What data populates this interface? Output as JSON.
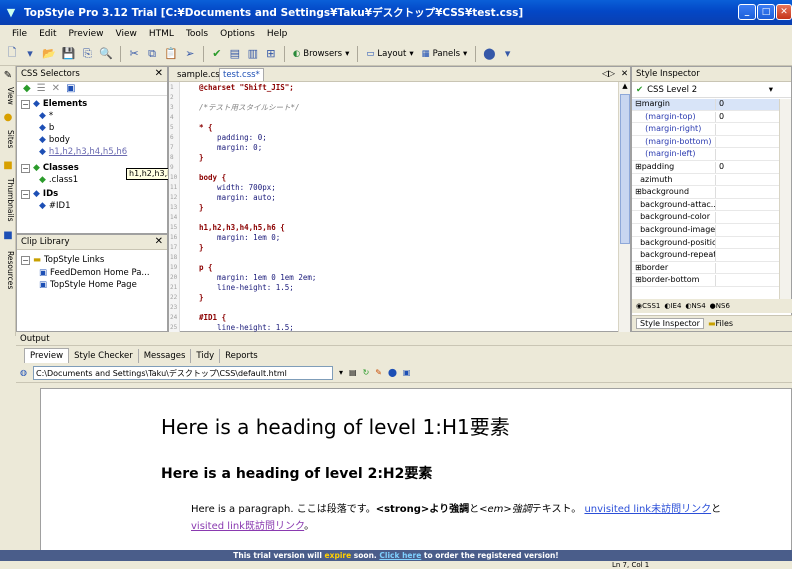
{
  "window": {
    "title": "TopStyle Pro 3.12 Trial  [C:¥Documents and Settings¥Taku¥デスクトップ¥CSS¥test.css]",
    "minimize": "_",
    "maximize": "□",
    "close": "✕"
  },
  "menu": [
    "File",
    "Edit",
    "Preview",
    "View",
    "HTML",
    "Tools",
    "Options",
    "Help"
  ],
  "toolbar": {
    "browsers_label": "Browsers",
    "layout_label": "Layout",
    "panels_label": "Panels"
  },
  "sidetabs": {
    "view": "View",
    "sites": "Sites",
    "thumbnails": "Thumbnails",
    "resources": "Resources"
  },
  "selectors_panel": {
    "title": "CSS Selectors",
    "elements_label": "Elements",
    "elements": [
      "*",
      "b",
      "body",
      "h1,h2,h3,h4,h5,h6"
    ],
    "classes_label": "Classes",
    "classes": [
      ".class1"
    ],
    "ids_label": "IDs",
    "ids": [
      "#ID1"
    ],
    "tooltip": "h1,h2,h3,h4,h5,h6"
  },
  "clip_library": {
    "title": "Clip Library",
    "group": "TopStyle Links",
    "items": [
      "FeedDemon Home Pa...",
      "TopStyle Home Page"
    ]
  },
  "editor": {
    "tabs": [
      "sample.css",
      "test.css*"
    ],
    "line_numbers": [
      "1",
      "2",
      "3",
      "4",
      "5",
      "6",
      "7",
      "8",
      "9",
      "10",
      "11",
      "12",
      "13",
      "14",
      "15",
      "16",
      "17",
      "18",
      "19",
      "20",
      "21",
      "22",
      "23",
      "24",
      "25"
    ],
    "lines": [
      {
        "text": "@charset \"Shift_JIS\";",
        "cls": "c-kw"
      },
      {
        "text": "",
        "cls": ""
      },
      {
        "text": "/*テスト用スタイルシート*/",
        "cls": "c-cmt"
      },
      {
        "text": "",
        "cls": ""
      },
      {
        "text": "* {",
        "cls": "c-kw"
      },
      {
        "text": "    padding: 0;",
        "cls": "c-prop"
      },
      {
        "text": "    margin: 0;",
        "cls": "c-prop"
      },
      {
        "text": "}",
        "cls": "c-kw"
      },
      {
        "text": "",
        "cls": ""
      },
      {
        "text": "body {",
        "cls": "c-kw"
      },
      {
        "text": "    width: 700px;",
        "cls": "c-prop"
      },
      {
        "text": "    margin: auto;",
        "cls": "c-prop"
      },
      {
        "text": "}",
        "cls": "c-kw"
      },
      {
        "text": "",
        "cls": ""
      },
      {
        "text": "h1,h2,h3,h4,h5,h6 {",
        "cls": "c-kw"
      },
      {
        "text": "    margin: 1em 0;",
        "cls": "c-prop"
      },
      {
        "text": "}",
        "cls": "c-kw"
      },
      {
        "text": "",
        "cls": ""
      },
      {
        "text": "p {",
        "cls": "c-kw"
      },
      {
        "text": "    margin: 1em 0 1em 2em;",
        "cls": "c-prop"
      },
      {
        "text": "    line-height: 1.5;",
        "cls": "c-prop"
      },
      {
        "text": "}",
        "cls": "c-kw"
      },
      {
        "text": "",
        "cls": ""
      },
      {
        "text": "#ID1 {",
        "cls": "c-kw"
      },
      {
        "text": "    line-height: 1.5;",
        "cls": "c-prop"
      }
    ]
  },
  "inspector": {
    "title": "Style Inspector",
    "level": "CSS Level 2",
    "props": [
      {
        "name": "⊟margin",
        "value": "0"
      },
      {
        "name": "    (margin-top)",
        "value": "0"
      },
      {
        "name": "    (margin-right)",
        "value": ""
      },
      {
        "name": "    (margin-bottom)",
        "value": ""
      },
      {
        "name": "    (margin-left)",
        "value": ""
      },
      {
        "name": "⊞padding",
        "value": "0"
      },
      {
        "name": "  azimuth",
        "value": ""
      },
      {
        "name": "⊞background",
        "value": ""
      },
      {
        "name": "  background-attac...",
        "value": ""
      },
      {
        "name": "  background-color",
        "value": ""
      },
      {
        "name": "  background-image",
        "value": ""
      },
      {
        "name": "  background-position",
        "value": ""
      },
      {
        "name": "  background-repeat",
        "value": ""
      },
      {
        "name": "⊞border",
        "value": ""
      },
      {
        "name": "⊞border-bottom",
        "value": ""
      }
    ],
    "browsers": [
      "CSS1",
      "IE4",
      "NS4",
      "NS6"
    ],
    "bottom_tabs": [
      "Style Inspector",
      "Files"
    ]
  },
  "output": {
    "title": "Output",
    "tabs": [
      "Preview",
      "Style Checker",
      "Messages",
      "Tidy",
      "Reports"
    ],
    "path": "C:\\Documents and Settings\\Taku\\デスクトップ\\CSS\\default.html",
    "h1": "Here is a heading of level 1:H1要素",
    "h2": "Here is a heading of level 2:H2要素",
    "para_start": "Here is a paragraph. ここは段落です。",
    "strong_tag": "<strong>",
    "strong_text": "より強調",
    "and_text": "と",
    "em_tag": "<em>",
    "em_text": "強調",
    "text_word": "テキスト。",
    "unvisited": "unvisited link未訪問リンク",
    "and2": "と",
    "visited": "visited link既訪問リンク",
    "para_end": "。"
  },
  "trial": {
    "part1": "This trial version will ",
    "expire": "expire",
    "part2": " soon. ",
    "click": "Click here",
    "part3": " to order the registered version!"
  },
  "status": {
    "position": "Ln 7, Col 1"
  }
}
